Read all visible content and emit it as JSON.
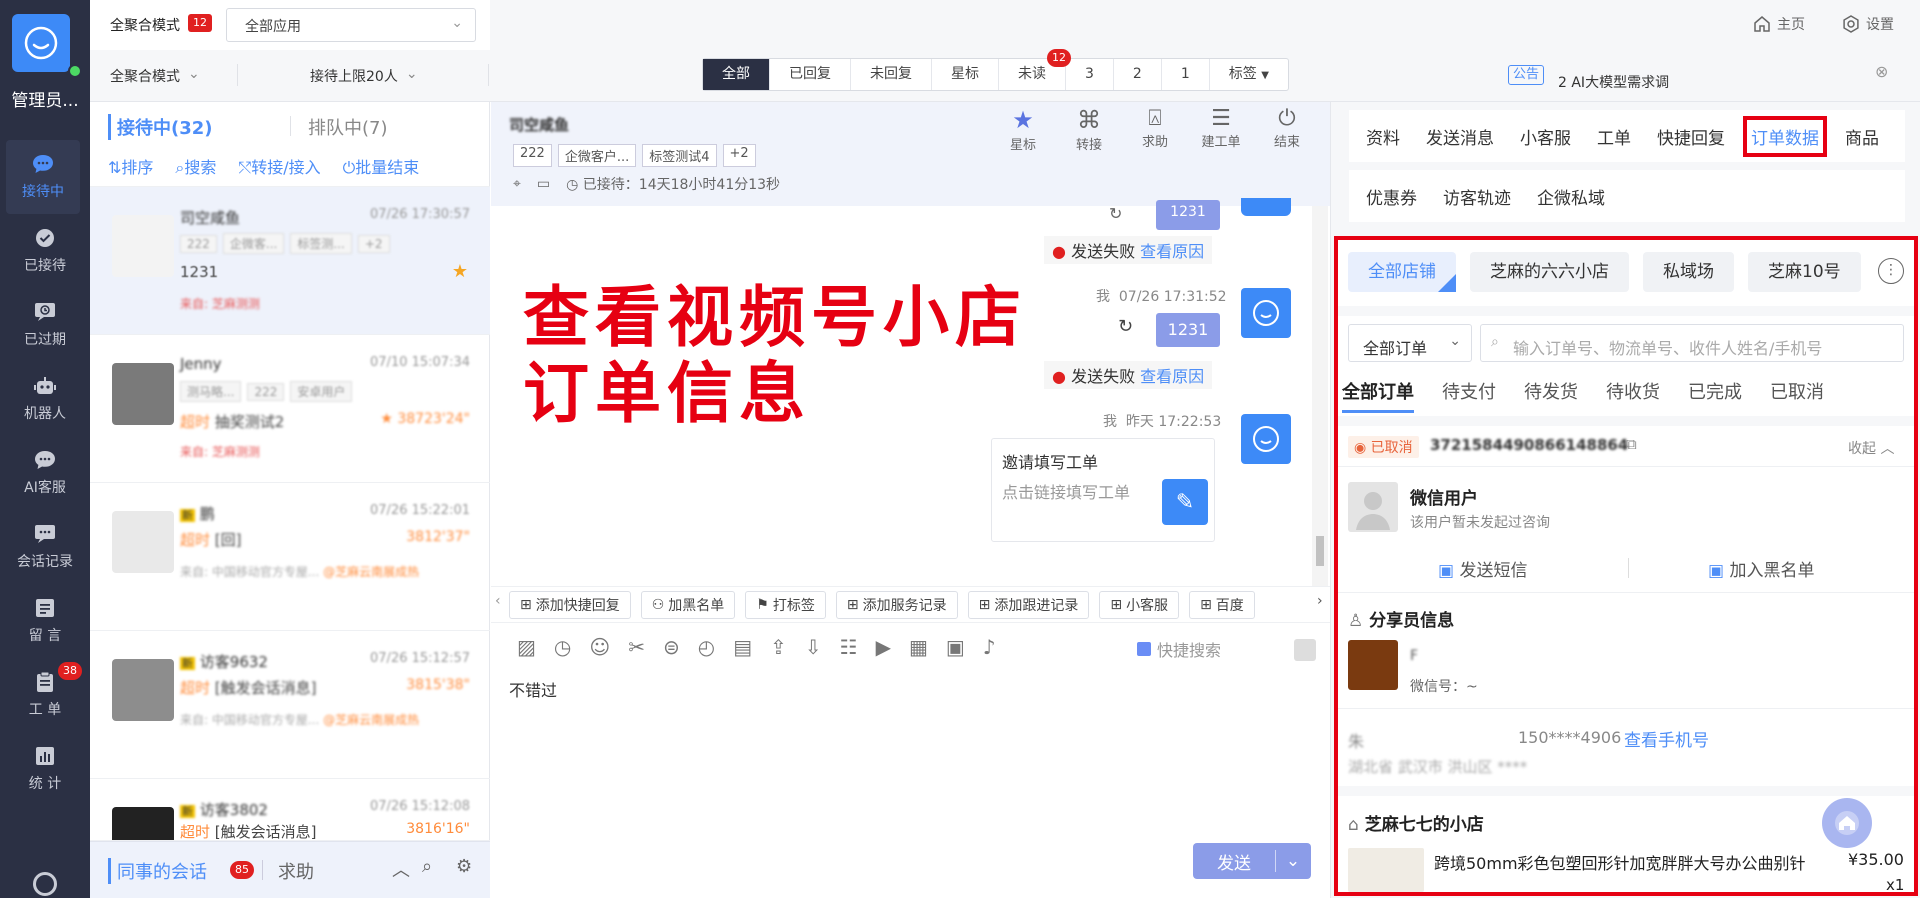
{
  "sidebar": {
    "admin": "管理员...",
    "items": [
      {
        "label": "接待中",
        "icon": "chat-bubble-icon",
        "active": true
      },
      {
        "label": "已接待",
        "icon": "check-circle-icon"
      },
      {
        "label": "已过期",
        "icon": "expired-chat-icon"
      },
      {
        "label": "机器人",
        "icon": "robot-icon"
      },
      {
        "label": "AI客服",
        "icon": "ai-chat-icon"
      },
      {
        "label": "会话记录",
        "icon": "chat-record-icon"
      },
      {
        "label": "留 言",
        "icon": "message-board-icon"
      },
      {
        "label": "工 单",
        "icon": "work-order-icon",
        "badge": "38"
      },
      {
        "label": "统 计",
        "icon": "stats-icon"
      }
    ]
  },
  "topbar": {
    "mode_label": "全聚合模式",
    "mode_badge": "12",
    "app_select": "全部应用",
    "home": "主页",
    "settings": "设置",
    "mode_select": "全聚合模式",
    "limit_select": "接待上限20人",
    "filters": [
      "全部",
      "已回复",
      "未回复",
      "星标",
      "未读",
      "3",
      "2",
      "1",
      "标签"
    ],
    "unread_badge": "12",
    "notice_tag": "公告",
    "notice_text": "2 AI大模型需求调研"
  },
  "list": {
    "tab_active": "接待中(32)",
    "tab_queue": "排队中(7)",
    "actions": [
      "排序",
      "搜索",
      "转接/接入",
      "批量结束"
    ],
    "conversations": [
      {
        "name": "司空咸鱼",
        "time": "07/26 17:30:57",
        "tags": [
          "222",
          "企微客...",
          "标签测...",
          "+2"
        ],
        "msg": "1231",
        "source": "来自: 芝麻测测"
      },
      {
        "name": "Jenny",
        "time": "07/10 15:07:34",
        "tags": [
          "测马略...",
          "222",
          "安卓用户"
        ],
        "prefix": "超时",
        "msg": "抽奖测试2",
        "wait": "38723'24\"",
        "source": "来自: 芝麻测测"
      },
      {
        "name": "鹏",
        "time": "07/26 15:22:01",
        "prefix": "超时",
        "msg": "[回]",
        "wait": "3812'37\"",
        "source": "来自: 中国移动官方专屋...",
        "shop": "@芝麻云南展成热"
      },
      {
        "name": "访客9632",
        "time": "07/26 15:12:57",
        "prefix": "超时",
        "msg": "[触发会话消息]",
        "wait": "3815'38\"",
        "source": "来自: 中国移动官方专屋...",
        "shop": "@芝麻云南展成热"
      },
      {
        "name": "访客3802",
        "time": "07/26 15:12:08",
        "prefix": "超时",
        "msg": "[触发会话消息]",
        "wait": "3816'16\""
      }
    ],
    "footer_colleague": "同事的会话",
    "footer_badge": "85",
    "footer_help": "求助"
  },
  "chat": {
    "name": "司空咸鱼",
    "tags": [
      "222",
      "企微客户...",
      "标签测试4",
      "+2"
    ],
    "wait": "已接待：14天18小时41分13秒",
    "actions": [
      {
        "label": "星标",
        "icon": "star-icon"
      },
      {
        "label": "转接",
        "icon": "transfer-icon"
      },
      {
        "label": "求助",
        "icon": "help-icon"
      },
      {
        "label": "建工单",
        "icon": "create-order-icon"
      },
      {
        "label": "结束",
        "icon": "power-icon"
      }
    ],
    "msg_top": "1231",
    "fail_text": "发送失败",
    "fail_link": "查看原因",
    "msg2_meta": "我  07/26 17:31:52",
    "msg2_text": "1231",
    "msg3_meta": "我  昨天 17:22:53",
    "card_title": "邀请填写工单",
    "card_sub": "点击链接填写工单",
    "overlay_line1": "查看视频号小店",
    "overlay_line2": "订单信息",
    "toolbar": [
      "添加快捷回复",
      "加黑名单",
      "打标签",
      "添加服务记录",
      "添加跟进记录",
      "小客服",
      "百度"
    ],
    "quick_search": "快捷搜索",
    "input_text": "不错过",
    "send": "发送"
  },
  "right": {
    "tabs_row1": [
      "资料",
      "发送消息",
      "小客服",
      "工单",
      "快捷回复",
      "订单数据",
      "商品"
    ],
    "tabs_row2": [
      "优惠券",
      "访客轨迹",
      "企微私域"
    ],
    "shops": [
      "全部店铺",
      "芝麻的六六小店",
      "私域场",
      "芝麻10号"
    ],
    "order_select": "全部订单",
    "search_placeholder": "输入订单号、物流单号、收件人姓名/手机号",
    "status_tabs": [
      "全部订单",
      "待支付",
      "待发货",
      "待收货",
      "已完成",
      "已取消"
    ],
    "order_status": "已取消",
    "order_no": "3721584490866148864",
    "collapse": "收起",
    "user_name": "微信用户",
    "user_note": "该用户暂未发起过咨询",
    "send_sms": "发送短信",
    "add_blacklist": "加入黑名单",
    "sharer_title": "分享员信息",
    "sharer_name": "F",
    "wechat": "微信号：~",
    "recv_name": "朱",
    "recv_phone": "150****4906",
    "view_phone": "查看手机号",
    "address": "湖北省 武汉市 洪山区 ****",
    "shop_name": "芝麻七七的小店",
    "product": "跨境50mm彩色包塑回形针加宽胖胖大号办公曲别针",
    "price": "¥35.00",
    "qty": "x1"
  }
}
